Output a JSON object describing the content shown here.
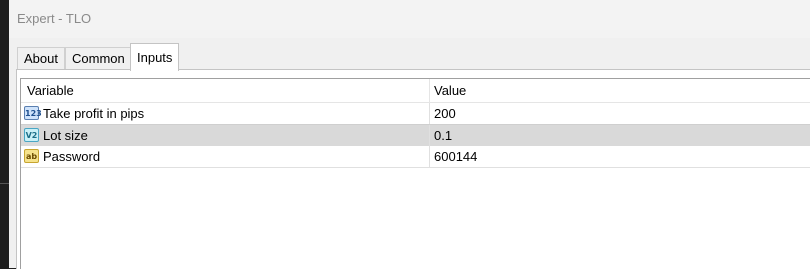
{
  "window": {
    "title": "Expert - TLO"
  },
  "tabs": [
    {
      "label": "About"
    },
    {
      "label": "Common"
    },
    {
      "label": "Inputs"
    }
  ],
  "active_tab": "Inputs",
  "table": {
    "columns": [
      "Variable",
      "Value"
    ],
    "rows": [
      {
        "icon": "integer-type-icon",
        "icon_text": "123",
        "variable": "Take profit in pips",
        "value": "200"
      },
      {
        "icon": "double-type-icon",
        "icon_text": "V2",
        "variable": "Lot size",
        "value": "0.1",
        "selected": true
      },
      {
        "icon": "string-type-icon",
        "icon_text": "ab",
        "variable": "Password",
        "value": "600144"
      }
    ]
  }
}
